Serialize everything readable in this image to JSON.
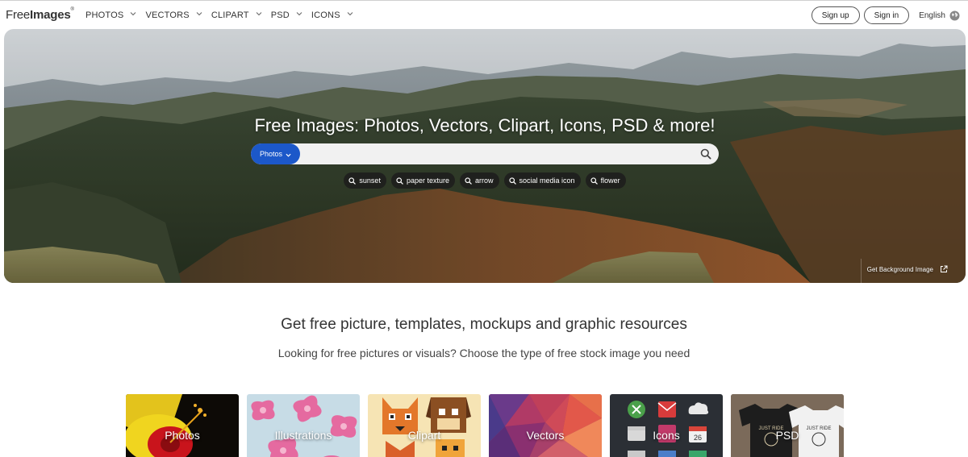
{
  "header": {
    "logo": {
      "text_light": "Free",
      "text_bold": "Images",
      "mark": "®"
    },
    "nav": [
      {
        "label": "PHOTOS"
      },
      {
        "label": "VECTORS"
      },
      {
        "label": "CLIPART"
      },
      {
        "label": "PSD"
      },
      {
        "label": "ICONS"
      }
    ],
    "signup_label": "Sign up",
    "signin_label": "Sign in",
    "language": "English",
    "language_icon": "globe-icon"
  },
  "hero": {
    "title": "Free Images: Photos, Vectors, Clipart, Icons, PSD & more!",
    "search": {
      "type_label": "Photos",
      "value": "",
      "placeholder": "",
      "button_icon": "search-icon"
    },
    "tags": [
      "sunset",
      "paper texture",
      "arrow",
      "social media icon",
      "flower"
    ],
    "bg_link": "Get Background Image",
    "bg_link_icon": "external-link-icon"
  },
  "section": {
    "heading": "Get free picture, templates, mockups and graphic resources",
    "subheading": "Looking for free pictures or visuals? Choose the type of free stock image you need"
  },
  "categories": [
    {
      "label": "Photos"
    },
    {
      "label": "Illustrations"
    },
    {
      "label": "Clipart"
    },
    {
      "label": "Vectors"
    },
    {
      "label": "Icons"
    },
    {
      "label": "PSD"
    }
  ],
  "colors": {
    "accent": "#1c58c9",
    "tag_bg": "#1c1c1c",
    "nav_text": "#333333"
  }
}
